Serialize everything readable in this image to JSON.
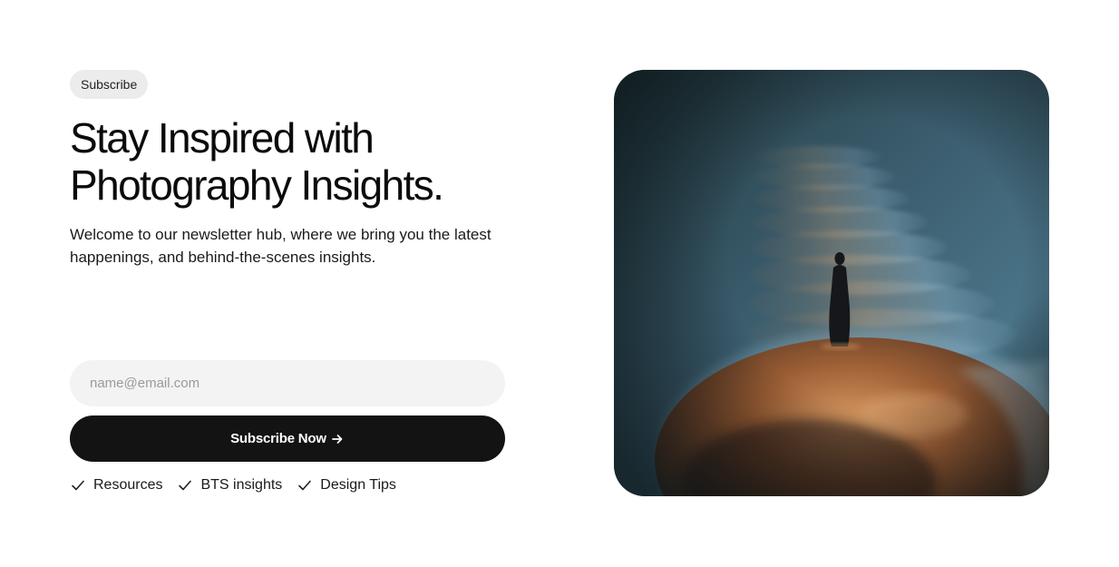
{
  "badge": {
    "label": "Subscribe"
  },
  "headline": {
    "line1": "Stay Inspired with",
    "line2": "Photography Insights."
  },
  "lead": "Welcome to our newsletter hub, where we bring you the latest happenings, and behind-the-scenes insights.",
  "form": {
    "email_placeholder": "name@email.com",
    "submit_label": "Subscribe Now",
    "submit_icon": "arrow-right-icon"
  },
  "features": [
    {
      "label": "Resources",
      "icon": "check-icon"
    },
    {
      "label": "BTS insights",
      "icon": "check-icon"
    },
    {
      "label": "Design Tips",
      "icon": "check-icon"
    }
  ],
  "colors": {
    "button_bg": "#131313",
    "input_bg": "#f3f3f3",
    "badge_bg": "#ececec"
  }
}
